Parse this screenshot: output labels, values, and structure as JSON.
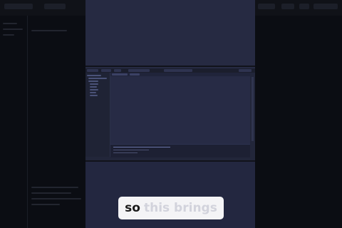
{
  "caption": {
    "spoken": "so",
    "upcoming": "this brings"
  },
  "colors": {
    "background": "#0d0f16",
    "video_panel": "#262a42",
    "caption_bg": "#f4f4f6",
    "caption_spoken": "#1a1a1a",
    "caption_upcoming": "#d2d3dc"
  }
}
